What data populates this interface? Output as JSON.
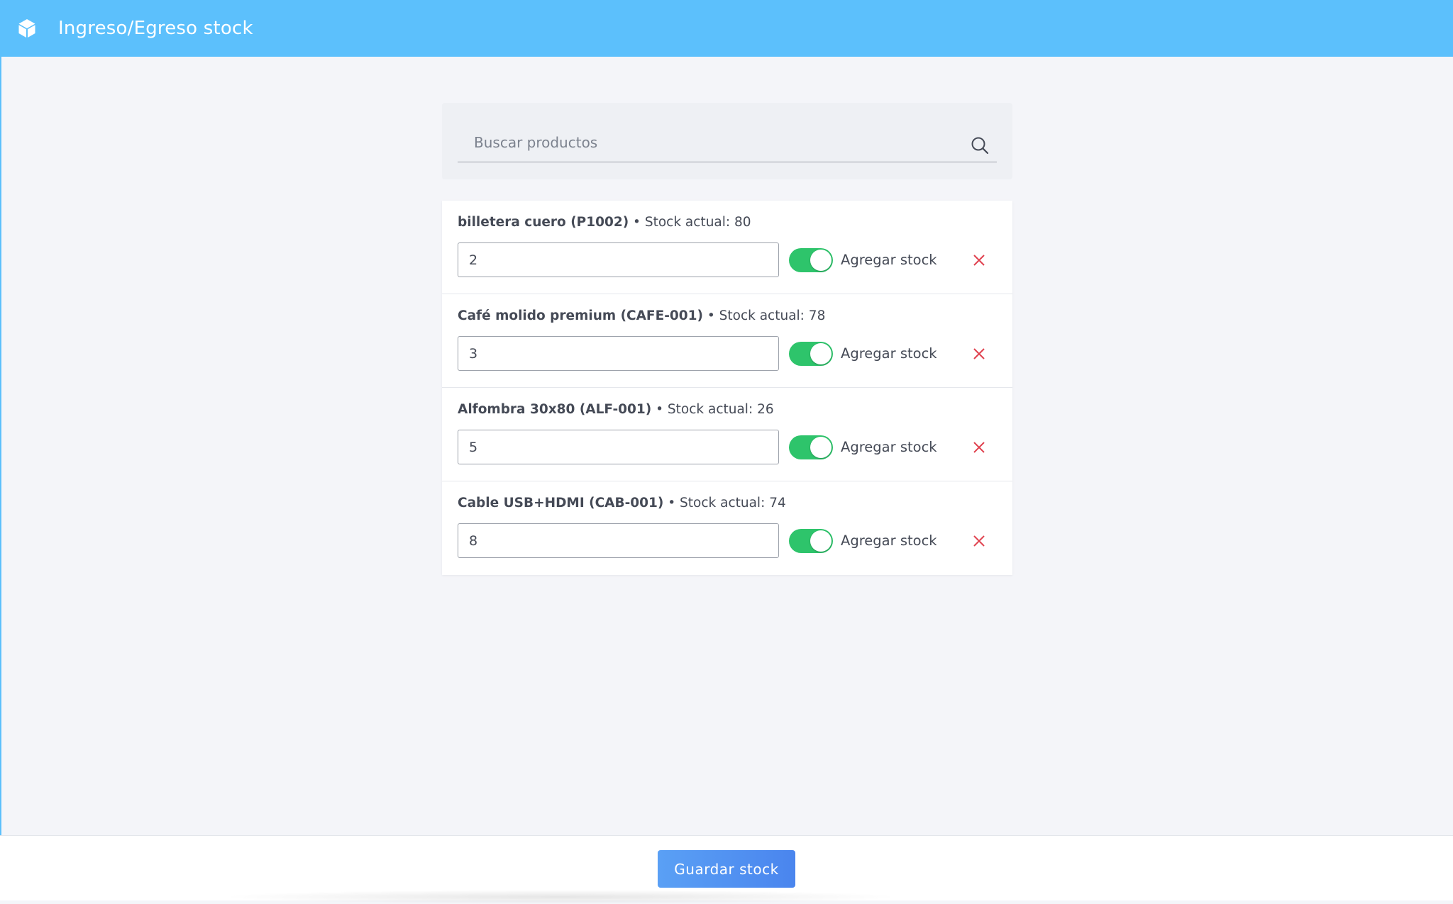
{
  "header": {
    "title": "Ingreso/Egreso stock",
    "icon": "cube-icon",
    "bg_color": "#5cc0fc"
  },
  "search": {
    "placeholder": "Buscar productos",
    "value": "",
    "icon": "search-icon"
  },
  "items": [
    {
      "name": "billetera cuero (P1002)",
      "stock_text": " • Stock actual: 80",
      "quantity": "2",
      "toggle_on": true,
      "toggle_label": "Agregar stock"
    },
    {
      "name": "Café molido premium (CAFE-001)",
      "stock_text": " • Stock actual: 78",
      "quantity": "3",
      "toggle_on": true,
      "toggle_label": "Agregar stock"
    },
    {
      "name": "Alfombra 30x80 (ALF-001)",
      "stock_text": " • Stock actual: 26",
      "quantity": "5",
      "toggle_on": true,
      "toggle_label": "Agregar stock"
    },
    {
      "name": "Cable USB+HDMI (CAB-001)",
      "stock_text": " • Stock actual: 74",
      "quantity": "8",
      "toggle_on": true,
      "toggle_label": "Agregar stock"
    }
  ],
  "footer": {
    "save_label": "Guardar stock"
  },
  "colors": {
    "accent": "#5cc0fc",
    "toggle_on": "#2ec46b",
    "remove": "#e0424f",
    "button": "#4f8ff0"
  }
}
